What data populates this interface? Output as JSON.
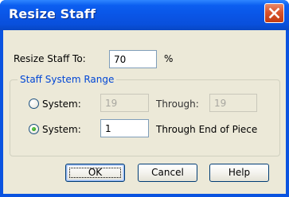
{
  "window": {
    "title": "Resize Staff"
  },
  "resize": {
    "label": "Resize Staff To:",
    "value": "70",
    "unit": "%"
  },
  "range": {
    "group_title": "Staff System Range",
    "option1": {
      "label": "System:",
      "from_value": "19",
      "through_label": "Through:",
      "through_value": "19",
      "selected": false
    },
    "option2": {
      "label": "System:",
      "from_value": "1",
      "through_label": "Through End of Piece",
      "selected": true
    }
  },
  "buttons": {
    "ok": "OK",
    "cancel": "Cancel",
    "help": "Help"
  },
  "icons": {
    "close": "close-icon"
  },
  "colors": {
    "titlebar": "#0a55e6",
    "dialog_bg": "#ece9d8",
    "group_title": "#0046d5",
    "close_button": "#d9532c"
  }
}
